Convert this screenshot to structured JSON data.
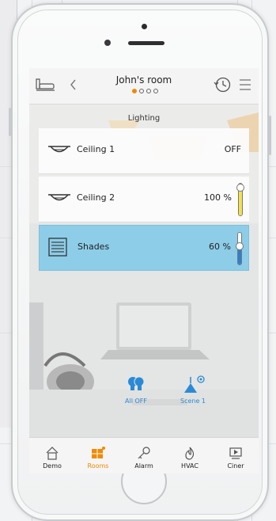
{
  "header": {
    "title": "John's room",
    "page_dots": 4,
    "active_dot": 0
  },
  "section": {
    "label": "Lighting"
  },
  "devices": [
    {
      "name": "Ceiling 1",
      "value": "OFF",
      "icon": "ceiling-lamp-icon"
    },
    {
      "name": "Ceiling 2",
      "value": "100 %",
      "icon": "ceiling-lamp-icon",
      "level": 1.0
    },
    {
      "name": "Shades",
      "value": "60 %",
      "icon": "shades-icon",
      "level": 0.6,
      "selected": true
    }
  ],
  "scenes": [
    {
      "label": "All OFF",
      "icon": "bulbs-icon"
    },
    {
      "label": "Scene 1",
      "icon": "scene-lamp-icon"
    }
  ],
  "tabs": [
    {
      "label": "Demo",
      "icon": "home-icon"
    },
    {
      "label": "Rooms",
      "icon": "rooms-icon",
      "active": true
    },
    {
      "label": "Alarm",
      "icon": "key-icon"
    },
    {
      "label": "HVAC",
      "icon": "flame-icon"
    },
    {
      "label": "Ciner",
      "icon": "cinema-icon"
    }
  ],
  "colors": {
    "accent": "#f08a00",
    "selected_row": "#88cbe8",
    "scene_blue": "#2b8ad6",
    "level_yellow": "#f2e24a",
    "level_blue": "#2f7fd0"
  }
}
